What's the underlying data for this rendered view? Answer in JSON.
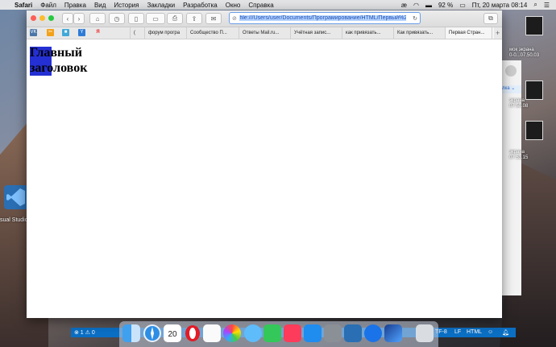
{
  "menubar": {
    "app": "Safari",
    "items": [
      "Файл",
      "Правка",
      "Вид",
      "История",
      "Закладки",
      "Разработка",
      "Окно",
      "Справка"
    ],
    "battery": "92 %",
    "clock": "Пт, 20 марта  08:14"
  },
  "browser": {
    "url": "file:///Users/user/Documents/Програмирование/HTML/Первый%20",
    "tabs": [
      "(",
      "форум програ",
      "Сообщество П...",
      "Ответы Mail.ru...",
      "Учётная запис...",
      "как привязать...",
      "Как привязать...",
      "Первая Стран..."
    ],
    "bookmark_icons": [
      "VK",
      "✂",
      "■",
      "Y",
      "Я"
    ]
  },
  "page": {
    "heading": "Главный заголовок"
  },
  "desktop": {
    "side_labels": [
      "мок экрана",
      "0-0...07.50.03",
      "экрана",
      "07.50.08",
      "экрана",
      "07.53.15"
    ],
    "vscode_label": "sual Studio"
  },
  "statusbar": {
    "left": "⊗ 1 ⚠ 0",
    "encoding": "TF-8",
    "eol": "LF",
    "lang": "HTML"
  },
  "dock": {
    "calendar_day": "20"
  },
  "colors": {
    "highlight": "#2430d3",
    "vscode_status": "#0b6fc4"
  }
}
